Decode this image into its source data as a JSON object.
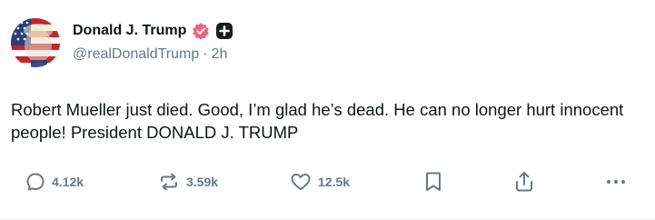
{
  "author": {
    "display_name": "Donald J. Trump",
    "handle": "@realDonaldTrump",
    "separator": "·",
    "time_ago": "2h",
    "verified_badge_color": "#f4617f",
    "plus_badge_color": "#1a1a1a"
  },
  "post": {
    "text": "Robert Mueller just died. Good, I’m glad he’s dead. He can no longer hurt innocent people! President DONALD J. TRUMP"
  },
  "actions": {
    "replies": "4.12k",
    "reposts": "3.59k",
    "likes": "12.5k",
    "icons": [
      "comment-icon",
      "repost-icon",
      "heart-icon",
      "bookmark-icon",
      "share-icon",
      "more-icon"
    ]
  },
  "colors": {
    "text": "#0f1419",
    "muted": "#6b7785"
  }
}
